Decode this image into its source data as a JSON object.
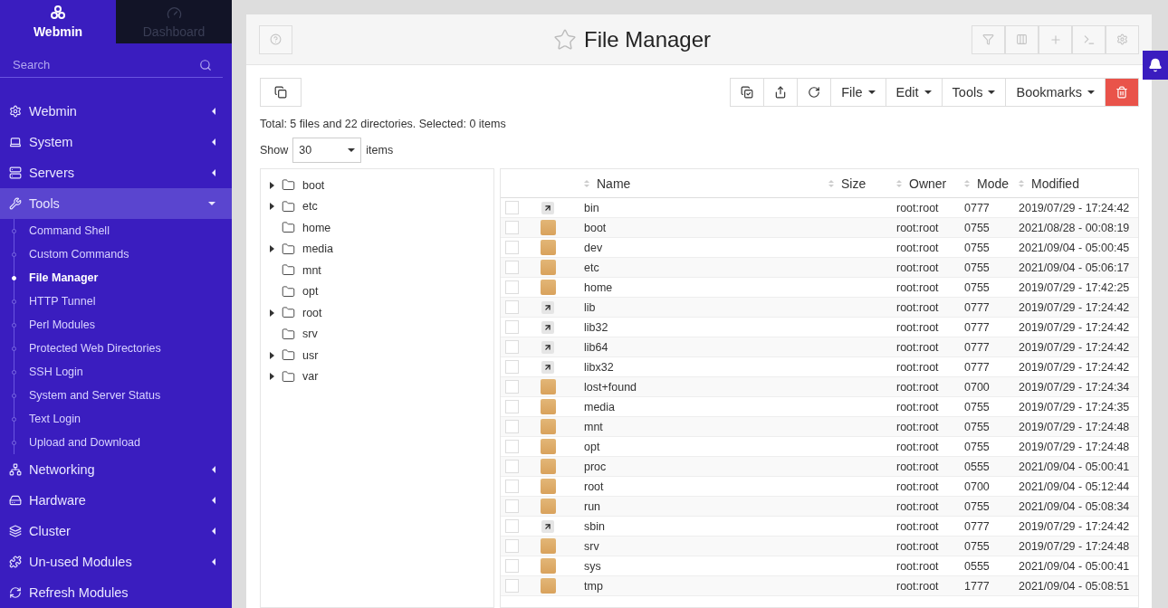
{
  "sidebar": {
    "tabs": [
      {
        "label": "Webmin",
        "selected": true
      },
      {
        "label": "Dashboard",
        "selected": false
      }
    ],
    "search": {
      "placeholder": "Search"
    },
    "menu": [
      {
        "kind": "gear",
        "label": "Webmin",
        "expanded": false
      },
      {
        "kind": "laptop",
        "label": "System",
        "expanded": false
      },
      {
        "kind": "server",
        "label": "Servers",
        "expanded": false
      },
      {
        "kind": "tools",
        "label": "Tools",
        "expanded": true,
        "children": [
          {
            "label": "Command Shell",
            "selected": false
          },
          {
            "label": "Custom Commands",
            "selected": false
          },
          {
            "label": "File Manager",
            "selected": true
          },
          {
            "label": "HTTP Tunnel",
            "selected": false
          },
          {
            "label": "Perl Modules",
            "selected": false
          },
          {
            "label": "Protected Web Directories",
            "selected": false
          },
          {
            "label": "SSH Login",
            "selected": false
          },
          {
            "label": "System and Server Status",
            "selected": false
          },
          {
            "label": "Text Login",
            "selected": false
          },
          {
            "label": "Upload and Download",
            "selected": false
          }
        ]
      },
      {
        "kind": "network",
        "label": "Networking",
        "expanded": false
      },
      {
        "kind": "hardware",
        "label": "Hardware",
        "expanded": false
      },
      {
        "kind": "cluster",
        "label": "Cluster",
        "expanded": false
      },
      {
        "kind": "puzzle",
        "label": "Un-used Modules",
        "expanded": false
      },
      {
        "kind": "refresh",
        "label": "Refresh Modules"
      }
    ]
  },
  "header": {
    "title": "File Manager"
  },
  "toolbar": {
    "menus": [
      "File",
      "Edit",
      "Tools",
      "Bookmarks"
    ]
  },
  "summary": "Total: 5 files and 22 directories. Selected: 0 items",
  "show": {
    "label": "Show",
    "value": "30",
    "suffix": "items"
  },
  "tree": [
    {
      "name": "boot",
      "expandable": true
    },
    {
      "name": "etc",
      "expandable": true
    },
    {
      "name": "home",
      "expandable": false
    },
    {
      "name": "media",
      "expandable": true
    },
    {
      "name": "mnt",
      "expandable": false
    },
    {
      "name": "opt",
      "expandable": false
    },
    {
      "name": "root",
      "expandable": true
    },
    {
      "name": "srv",
      "expandable": false
    },
    {
      "name": "usr",
      "expandable": true
    },
    {
      "name": "var",
      "expandable": true
    }
  ],
  "table": {
    "columns": [
      "Name",
      "Size",
      "Owner",
      "Mode",
      "Modified"
    ],
    "rows": [
      {
        "kind": "link",
        "name": "bin",
        "owner": "root:root",
        "mode": "0777",
        "modified": "2019/07/29 - 17:24:42",
        "checked": false
      },
      {
        "kind": "folder",
        "name": "boot",
        "owner": "root:root",
        "mode": "0755",
        "modified": "2021/08/28 - 00:08:19",
        "checked": false
      },
      {
        "kind": "folder",
        "name": "dev",
        "owner": "root:root",
        "mode": "0755",
        "modified": "2021/09/04 - 05:00:45",
        "checked": false
      },
      {
        "kind": "folder",
        "name": "etc",
        "owner": "root:root",
        "mode": "0755",
        "modified": "2021/09/04 - 05:06:17",
        "checked": false
      },
      {
        "kind": "folder",
        "name": "home",
        "owner": "root:root",
        "mode": "0755",
        "modified": "2019/07/29 - 17:42:25",
        "checked": false
      },
      {
        "kind": "link",
        "name": "lib",
        "owner": "root:root",
        "mode": "0777",
        "modified": "2019/07/29 - 17:24:42",
        "checked": false
      },
      {
        "kind": "link",
        "name": "lib32",
        "owner": "root:root",
        "mode": "0777",
        "modified": "2019/07/29 - 17:24:42",
        "checked": false
      },
      {
        "kind": "link",
        "name": "lib64",
        "owner": "root:root",
        "mode": "0777",
        "modified": "2019/07/29 - 17:24:42",
        "checked": false
      },
      {
        "kind": "link",
        "name": "libx32",
        "owner": "root:root",
        "mode": "0777",
        "modified": "2019/07/29 - 17:24:42",
        "checked": false
      },
      {
        "kind": "folder",
        "name": "lost+found",
        "owner": "root:root",
        "mode": "0700",
        "modified": "2019/07/29 - 17:24:34",
        "checked": false
      },
      {
        "kind": "folder",
        "name": "media",
        "owner": "root:root",
        "mode": "0755",
        "modified": "2019/07/29 - 17:24:35",
        "checked": false
      },
      {
        "kind": "folder",
        "name": "mnt",
        "owner": "root:root",
        "mode": "0755",
        "modified": "2019/07/29 - 17:24:48",
        "checked": false
      },
      {
        "kind": "folder",
        "name": "opt",
        "owner": "root:root",
        "mode": "0755",
        "modified": "2019/07/29 - 17:24:48",
        "checked": false
      },
      {
        "kind": "folder",
        "name": "proc",
        "owner": "root:root",
        "mode": "0555",
        "modified": "2021/09/04 - 05:00:41",
        "checked": false
      },
      {
        "kind": "folder",
        "name": "root",
        "owner": "root:root",
        "mode": "0700",
        "modified": "2021/09/04 - 05:12:44",
        "checked": false
      },
      {
        "kind": "folder",
        "name": "run",
        "owner": "root:root",
        "mode": "0755",
        "modified": "2021/09/04 - 05:08:34",
        "checked": false
      },
      {
        "kind": "link",
        "name": "sbin",
        "owner": "root:root",
        "mode": "0777",
        "modified": "2019/07/29 - 17:24:42",
        "checked": false
      },
      {
        "kind": "folder",
        "name": "srv",
        "owner": "root:root",
        "mode": "0755",
        "modified": "2019/07/29 - 17:24:48",
        "checked": false
      },
      {
        "kind": "folder",
        "name": "sys",
        "owner": "root:root",
        "mode": "0555",
        "modified": "2021/09/04 - 05:00:41",
        "checked": false
      },
      {
        "kind": "folder",
        "name": "tmp",
        "owner": "root:root",
        "mode": "1777",
        "modified": "2021/09/04 - 05:08:51",
        "checked": false
      }
    ]
  }
}
